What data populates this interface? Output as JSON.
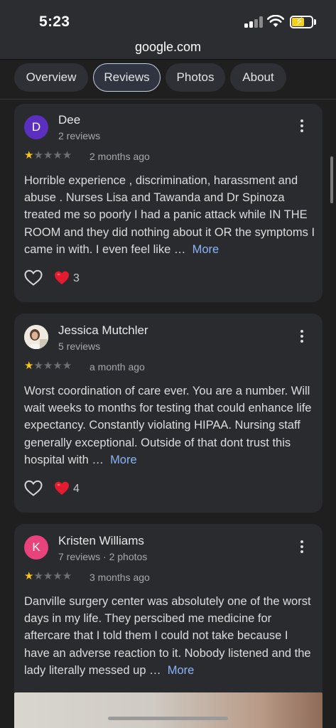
{
  "status_bar": {
    "time": "5:23"
  },
  "browser": {
    "url": "google.com"
  },
  "tabs": [
    {
      "label": "Overview",
      "active": false
    },
    {
      "label": "Reviews",
      "active": true
    },
    {
      "label": "Photos",
      "active": false
    },
    {
      "label": "About",
      "active": false
    }
  ],
  "reviews": [
    {
      "initial": "D",
      "avatar_color": "#5b2fbf",
      "author": "Dee",
      "meta": "2 reviews",
      "rating": 1,
      "time_ago": "2 months ago",
      "text": "Horrible experience , discrimination, harassment and abuse . Nurses Lisa and Tawanda and Dr Spinoza treated me so poorly I had a panic attack while IN THE ROOM and they did nothing about it OR the symptoms I came in with. I even feel like …",
      "more_label": "More",
      "reaction_count": "3"
    },
    {
      "initial": "",
      "avatar_color": "#d9d2c8",
      "author": "Jessica Mutchler",
      "meta": "5 reviews",
      "rating": 1,
      "time_ago": "a month ago",
      "text": "Worst coordination of care ever. You are a number. Will wait weeks to months for testing that could enhance life expectancy. Constantly violating HIPAA. Nursing staff generally exceptional. Outside of that dont trust this hospital with …",
      "more_label": "More",
      "reaction_count": "4"
    },
    {
      "initial": "K",
      "avatar_color": "#e8437a",
      "author": "Kristen Williams",
      "meta": "7 reviews · 2 photos",
      "rating": 1,
      "time_ago": "3 months ago",
      "text": "Danville surgery center was absolutely one of the worst days in my life. They perscibed me medicine for aftercare that I told them I could not take because I have an adverse reaction to it. Nobody listened and the lady literally messed up …",
      "more_label": "More"
    }
  ],
  "icons": [
    "kebab-menu-icon",
    "heart-outline-icon",
    "red-heart-emoji-icon",
    "star-icon"
  ],
  "colors": {
    "link": "#8ab4f8",
    "star": "#f5c518",
    "background": "#1f1f1f",
    "card": "#2a2b2f"
  }
}
